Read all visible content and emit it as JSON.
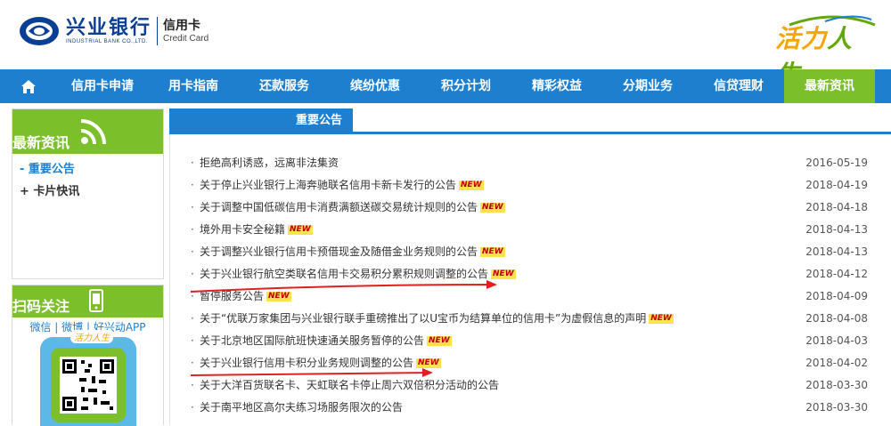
{
  "header": {
    "bank_name_cn": "兴业银行",
    "bank_name_en": "INDUSTRIAL BANK CO.,LTD.",
    "card_cn": "信用卡",
    "card_en": "Credit Card",
    "slogan_a": "活力",
    "slogan_b": "人生"
  },
  "nav": {
    "items": [
      "信用卡申请",
      "用卡指南",
      "还款服务",
      "缤纷优惠",
      "积分计划",
      "精彩权益",
      "分期业务",
      "信贷理财",
      "最新资讯"
    ],
    "active_index": 8
  },
  "sidebar": {
    "title": "最新资讯",
    "items": [
      {
        "prefix": "- ",
        "label": "重要公告"
      },
      {
        "prefix": "+ ",
        "label": "卡片快讯"
      }
    ],
    "scan_title": "扫码关注",
    "social": "微信 | 微博 | 好兴动APP",
    "qr_badge": "活力人生"
  },
  "main": {
    "tab_label": "重要公告",
    "new_label": "NEW",
    "rows": [
      {
        "title": "拒绝高利诱惑，远离非法集资",
        "date": "2016-05-19",
        "new": false
      },
      {
        "title": "关于停止兴业银行上海奔驰联名信用卡新卡发行的公告",
        "date": "2018-04-19",
        "new": true
      },
      {
        "title": "关于调整中国低碳信用卡消费满额送碳交易统计规则的公告",
        "date": "2018-04-18",
        "new": true
      },
      {
        "title": "境外用卡安全秘籍",
        "date": "2018-04-13",
        "new": true
      },
      {
        "title": "关于调整兴业银行信用卡预借现金及随借金业务规则的公告",
        "date": "2018-04-13",
        "new": true
      },
      {
        "title": "关于兴业银行航空类联名信用卡交易积分累积规则调整的公告",
        "date": "2018-04-12",
        "new": true
      },
      {
        "title": "暂停服务公告",
        "date": "2018-04-09",
        "new": true
      },
      {
        "title": "关于“优联万家集团与兴业银行联手重磅推出了以U宝币为结算单位的信用卡”为虚假信息的声明",
        "date": "2018-04-08",
        "new": true
      },
      {
        "title": "关于北京地区国际航班快速通关服务暂停的公告",
        "date": "2018-04-03",
        "new": true
      },
      {
        "title": "关于兴业银行信用卡积分业务规则调整的公告",
        "date": "2018-04-02",
        "new": true
      },
      {
        "title": "关于大洋百货联名卡、天虹联名卡停止周六双倍积分活动的公告",
        "date": "2018-03-30",
        "new": false
      },
      {
        "title": "关于南平地区高尔夫练习场服务限次的公告",
        "date": "2018-03-30",
        "new": false
      }
    ]
  },
  "colors": {
    "nav_blue": "#1f7fcf",
    "accent_green": "#7bbf2b",
    "annotation_red": "#e02020"
  }
}
